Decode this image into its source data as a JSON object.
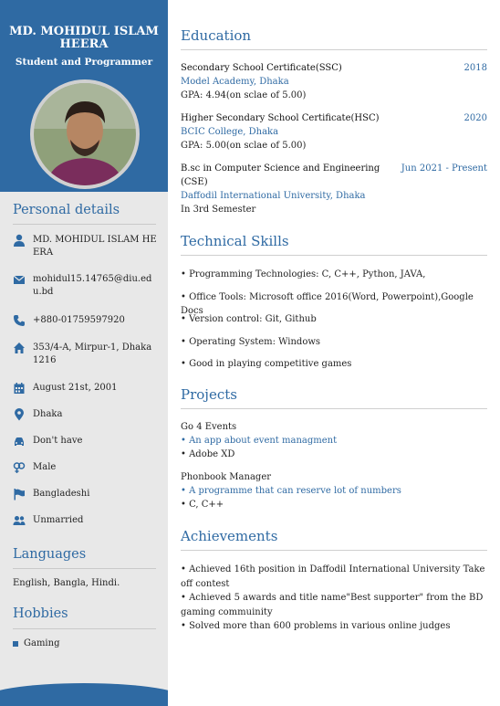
{
  "header": {
    "name": "MD. MOHIDUL ISLAM HEERA",
    "role": "Student and Programmer"
  },
  "personal": {
    "title": "Personal details",
    "items": [
      {
        "icon": "user-icon",
        "text": "MD. MOHIDUL ISLAM HEERA"
      },
      {
        "icon": "email-icon",
        "text": "mohidul15.14765@diu.edu.bd"
      },
      {
        "icon": "phone-icon",
        "text": "+880-01759597920"
      },
      {
        "icon": "home-icon",
        "text": "353/4-A, Mirpur-1, Dhaka 1216"
      },
      {
        "icon": "calendar-icon",
        "text": "August 21st, 2001"
      },
      {
        "icon": "location-icon",
        "text": "Dhaka"
      },
      {
        "icon": "car-icon",
        "text": "Don't have"
      },
      {
        "icon": "gender-icon",
        "text": "Male"
      },
      {
        "icon": "flag-icon",
        "text": "Bangladeshi"
      },
      {
        "icon": "users-icon",
        "text": "Unmarried"
      }
    ]
  },
  "languages": {
    "title": "Languages",
    "text": "English, Bangla, Hindi."
  },
  "hobbies": {
    "title": "Hobbies",
    "items": [
      "Gaming"
    ]
  },
  "education": {
    "title": "Education",
    "items": [
      {
        "degree": "Secondary School Certificate(SSC)",
        "year": "2018",
        "institution": "Model Academy, Dhaka",
        "detail": "GPA: 4.94(on sclae of 5.00)"
      },
      {
        "degree": "Higher Secondary School Certificate(HSC)",
        "year": "2020",
        "institution": "BCIC College, Dhaka",
        "detail": "GPA: 5.00(on sclae of 5.00)"
      },
      {
        "degree": "B.sc in Computer Science and Engineering (CSE)",
        "year": "Jun 2021 - Present",
        "institution": "Daffodil International University, Dhaka",
        "detail": "In 3rd Semester"
      }
    ]
  },
  "skills": {
    "title": "Technical Skills",
    "items": [
      "• Programming Technologies: C, C++, Python, JAVA,",
      "• Office Tools: Microsoft office 2016(Word, Powerpoint),Google Docs",
      "• Version control: Git, Github",
      "• Operating System: Windows",
      "• Good in playing competitive games"
    ]
  },
  "projects": {
    "title": "Projects",
    "items": [
      {
        "name": "Go 4 Events",
        "desc": "• An app about event managment",
        "tech": "• Adobe XD"
      },
      {
        "name": "Phonbook Manager",
        "desc": "• A programme that can reserve lot of numbers",
        "tech": "• C, C++"
      }
    ]
  },
  "achievements": {
    "title": "Achievements",
    "items": [
      "• Achieved 16th position in Daffodil International University Take off contest",
      "• Achieved 5 awards and title name\"Best supporter\" from the BD gaming commuinity",
      "• Solved more than 600 problems in various online judges"
    ]
  },
  "colors": {
    "accent": "#2f6aa3",
    "sidebar": "#e8e8e8"
  }
}
